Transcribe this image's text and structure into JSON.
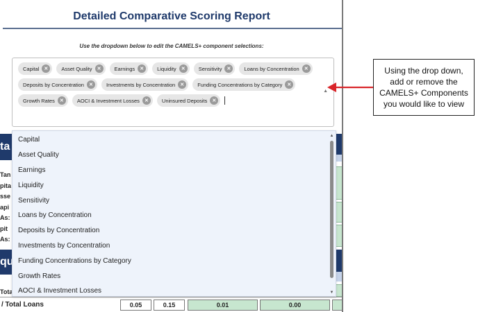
{
  "report": {
    "title": "Detailed Comparative Scoring Report",
    "instructions": "Use the dropdown below to edit the CAMELS+ component selections:"
  },
  "selected_components": [
    "Capital",
    "Asset Quality",
    "Earnings",
    "Liquidity",
    "Sensitivity",
    "Loans by Concentration",
    "Deposits by Concentration",
    "Investments by Concentration",
    "Funding Concentrations by Category",
    "Growth Rates",
    "AOCI & Investment Losses",
    "Uninsured Deposits"
  ],
  "dropdown_options": [
    "Capital",
    "Asset Quality",
    "Earnings",
    "Liquidity",
    "Sensitivity",
    "Loans by Concentration",
    "Deposits by Concentration",
    "Investments by Concentration",
    "Funding Concentrations by Category",
    "Growth Rates",
    "AOCI & Investment Losses"
  ],
  "background_table": {
    "fragments": {
      "header_1": "ta",
      "row_1": "Tan",
      "row_2": "pita",
      "row_3": "sse",
      "row_4": "api",
      "row_5": "As:",
      "row_6": "pit",
      "row_7": "As:",
      "header_2": "qu",
      "row_8": "Tota"
    },
    "bottom_row": {
      "label": "/ Total Loans",
      "values": [
        "0.05",
        "0.15",
        "0.01",
        "0.00"
      ]
    }
  },
  "callout": {
    "text": "Using the drop down, add or remove the CAMELS+ Components you would like to view"
  },
  "icons": {
    "chip_remove": "close-circle-icon",
    "toggle": "caret-up-icon",
    "arrow": "left-arrow-icon"
  },
  "colors": {
    "title": "#1f3a6b",
    "navy": "#1f3a6b",
    "green": "#c7e6cf",
    "arrow": "#d9252a"
  }
}
